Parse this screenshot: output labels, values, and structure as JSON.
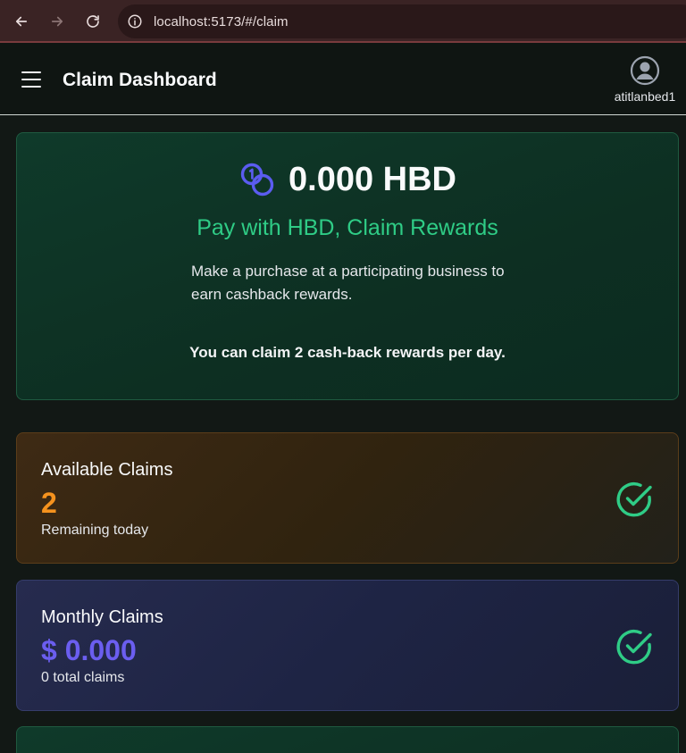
{
  "browser": {
    "url": "localhost:5173/#/claim",
    "back_icon": "arrow-left-icon",
    "forward_icon": "arrow-right-icon",
    "reload_icon": "reload-icon",
    "info_icon": "info-icon"
  },
  "header": {
    "title": "Claim Dashboard",
    "menu_icon": "hamburger-menu-icon",
    "avatar_icon": "user-avatar-icon",
    "username": "atitlanbed1"
  },
  "hero": {
    "icon": "coins-icon",
    "amount": "0.000 HBD",
    "subtitle": "Pay with HBD, Claim Rewards",
    "description": "Make a purchase at a participating business to earn cashback rewards.",
    "note": "You can claim 2 cash-back rewards per day."
  },
  "available_claims": {
    "label": "Available Claims",
    "value": "2",
    "sub": "Remaining today",
    "icon": "check-circle-icon"
  },
  "monthly_claims": {
    "label": "Monthly Claims",
    "value": "$ 0.000",
    "sub": "0 total claims",
    "icon": "check-circle-icon"
  },
  "colors": {
    "accent_green": "#2fcc86",
    "orange": "#f5921e",
    "indigo": "#6b5ef0",
    "coin_blue": "#5b5cf0"
  }
}
